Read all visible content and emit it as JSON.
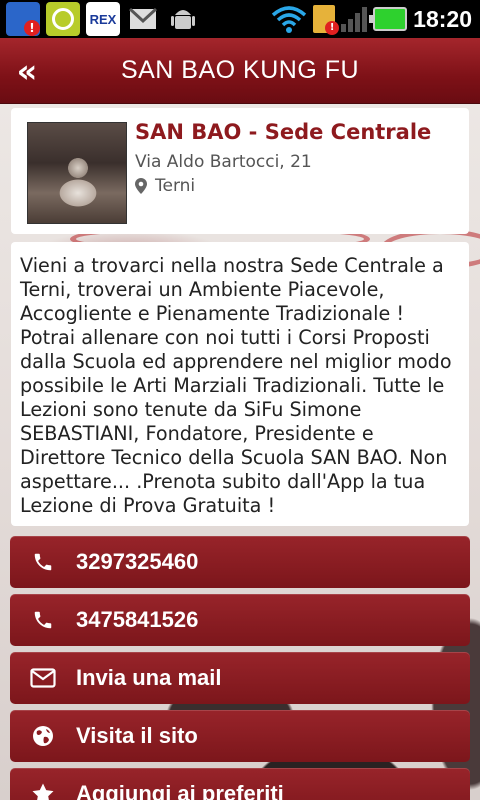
{
  "status_bar": {
    "time": "18:20",
    "notification_icons": [
      "sd-card-icon",
      "music-app-icon",
      "rex-app-icon",
      "gmail-icon",
      "android-icon"
    ]
  },
  "header": {
    "back_label": "«",
    "title": "SAN BAO KUNG FU"
  },
  "location": {
    "name": "SAN BAO - Sede Centrale",
    "street": "Via Aldo Bartocci, 21",
    "city": "Terni"
  },
  "description": "Vieni a trovarci nella nostra Sede Centrale a Terni, troverai un Ambiente Piacevole, Accogliente e Pienamente Tradizionale ! Potrai allenare con noi tutti i Corsi Proposti dalla Scuola ed apprendere nel miglior modo possibile le Arti Marziali Tradizionali. Tutte le Lezioni sono tenute da SiFu Simone SEBASTIANI, Fondatore, Presidente e Direttore Tecnico della Scuola SAN BAO. Non aspettare... .Prenota subito dall'App la tua Lezione di Prova Gratuita !",
  "actions": [
    {
      "label": "3297325460",
      "icon": "phone-icon"
    },
    {
      "label": "3475841526",
      "icon": "phone-icon"
    },
    {
      "label": "Invia una mail",
      "icon": "mail-icon"
    },
    {
      "label": "Visita il sito",
      "icon": "globe-icon"
    },
    {
      "label": "Aggiungi ai preferiti",
      "icon": "star-icon"
    }
  ],
  "colors": {
    "brand_red": "#8e1a1e",
    "header_red": "#7e1117",
    "battery_green": "#2ed12e"
  }
}
